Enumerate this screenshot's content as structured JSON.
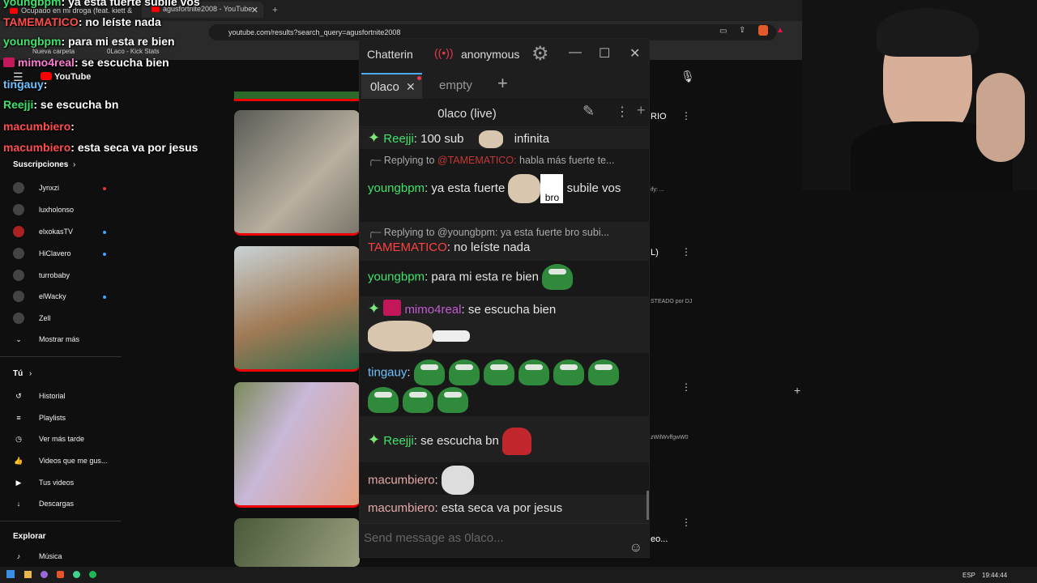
{
  "browser": {
    "tab1_title": "Ocupado en mi droga (feat. kiett &",
    "tab2_title": "agusfortnite2008 - YouTube",
    "url": "youtube.com/results?search_query=agusfortnite2008",
    "bookmark1": "Nueva carpeta",
    "bookmark2": "0Laco - Kick Stats"
  },
  "youtube": {
    "logo": "YouTube",
    "subs_header": "Suscripciones",
    "subs": [
      "Jynxzi",
      "luxholonso",
      "elxokasTV",
      "HiClavero",
      "turrobaby",
      "elWacky",
      "Zell",
      "Mostrar más"
    ],
    "you_header": "Tú",
    "you_items": [
      "Historial",
      "Playlists",
      "Ver más tarde",
      "Videos que me gus...",
      "Tus videos",
      "Descargas"
    ],
    "explore_header": "Explorar",
    "explore_items": [
      "Música"
    ],
    "right_texts": [
      "RIO",
      "ify: ...",
      "L)",
      "STEADO por DJ",
      "zWilWvffgwW0",
      "eo..."
    ]
  },
  "overlay": [
    {
      "user": "youngbpm",
      "text": "ya esta fuerte",
      "tail": "subile vos"
    },
    {
      "user": "TAMEMATICO",
      "text": "no leíste nada"
    },
    {
      "user": "youngbpm",
      "text": "para mi esta re bien"
    },
    {
      "user": "mimo4real",
      "text": "se escucha bien"
    },
    {
      "user": "tingauy",
      "text": ""
    },
    {
      "user": "Reejji",
      "text": "se escucha bn"
    },
    {
      "user": "macumbiero",
      "text": ""
    },
    {
      "user": "macumbiero",
      "text": "esta seca va por jesus"
    }
  ],
  "chatterino": {
    "app_name": "Chatterin",
    "account": "anonymous",
    "tabs": [
      "0laco",
      "empty"
    ],
    "channel_title": "0laco (live)",
    "input_placeholder": "Send message as 0laco...",
    "messages": [
      {
        "user": "Reejji",
        "text": "100 sub",
        "tail": "infinita"
      },
      {
        "reply": "Replying to",
        "reply_user": "@TAMEMATICO:",
        "reply_text": "habla más fuerte te...",
        "user": "youngbpm",
        "text": "ya esta fuerte",
        "emote": "bro",
        "tail": "subile vos"
      },
      {
        "reply": "Replying to",
        "reply_user": "@youngbpm:",
        "reply_text": "ya esta fuerte bro subi...",
        "user": "TAMEMATICO",
        "text": "no leíste nada"
      },
      {
        "user": "youngbpm",
        "text": "para mi esta re bien"
      },
      {
        "user": "mimo4real",
        "text": "se escucha bien"
      },
      {
        "user": "tingauy",
        "text": ""
      },
      {
        "user": "Reejji",
        "text": "se escucha bn"
      },
      {
        "user": "macumbiero",
        "text": ""
      },
      {
        "user": "macumbiero",
        "text": "esta seca va por jesus"
      }
    ]
  },
  "taskbar": {
    "lang": "ESP",
    "time": "19:44:44"
  }
}
